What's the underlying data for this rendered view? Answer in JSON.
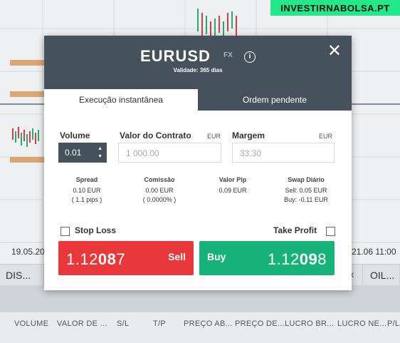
{
  "watermark": "INVESTIRNABOLSA.PT",
  "background": {
    "date_left": "19.05.20",
    "date_right": "21.06 11:00",
    "tabs": [
      {
        "label": "DIS..."
      },
      {
        "label": "OIL..."
      }
    ],
    "columns": [
      "VOLUME",
      "VALOR DE ...",
      "S/L",
      "T/P",
      "PREÇO AB...",
      "PREÇO DE...",
      "LUCRO BR...",
      "LUCRO NE...",
      "P/L"
    ]
  },
  "modal": {
    "symbol": "EURUSD",
    "asset_class": "FX",
    "validity": "Validade: 365 dias",
    "tabs": {
      "instant": "Execução instantânea",
      "pending": "Ordem pendente"
    },
    "volume": {
      "label": "Volume",
      "value": "0.01"
    },
    "contract_value": {
      "label": "Valor do Contrato",
      "currency": "EUR",
      "value": "1 000.00"
    },
    "margin": {
      "label": "Margem",
      "currency": "EUR",
      "value": "33.30"
    },
    "spread": {
      "label": "Spread",
      "line1": "0.10 EUR",
      "line2": "( 1.1 pips )"
    },
    "commission": {
      "label": "Comissão",
      "line1": "0.00 EUR",
      "line2": "( 0.0000% )"
    },
    "pip_value": {
      "label": "Valor Pip",
      "line1": "0.09 EUR"
    },
    "swap": {
      "label": "Swap Diário",
      "line1": "Sell: 0.05 EUR",
      "line2": "Buy: -0.11 EUR"
    },
    "stop_loss": {
      "label": "Stop Loss",
      "checked": false
    },
    "take_profit": {
      "label": "Take Profit",
      "checked": false
    },
    "sell": {
      "label": "Sell",
      "price_prefix": "1.12",
      "price_big": "08",
      "price_suffix": "7",
      "color": "#e8383b"
    },
    "buy": {
      "label": "Buy",
      "price_prefix": "1.12",
      "price_big": "09",
      "price_suffix": "8",
      "color": "#17b27a"
    }
  }
}
